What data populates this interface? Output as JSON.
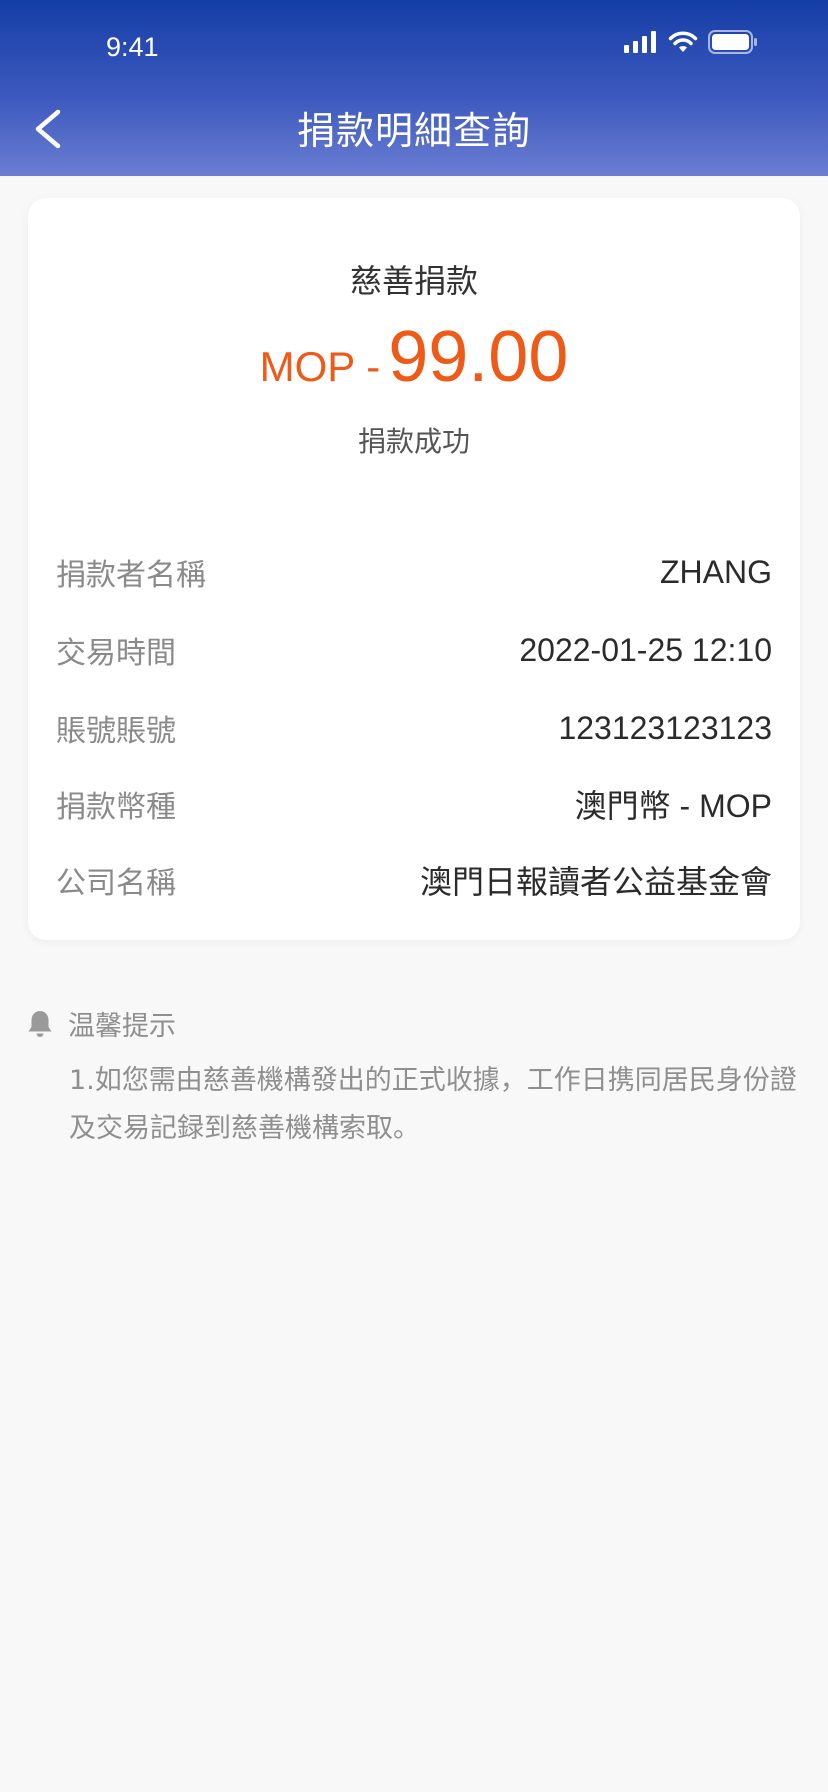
{
  "status_bar": {
    "time": "9:41"
  },
  "header": {
    "title": "捐款明細查詢"
  },
  "summary": {
    "title": "慈善捐款",
    "amount_prefix": "MOP -",
    "amount": "99.00",
    "status": "捐款成功"
  },
  "details": [
    {
      "label": "捐款者名稱",
      "value": "ZHANG"
    },
    {
      "label": "交易時間",
      "value": "2022-01-25 12:10"
    },
    {
      "label": "賬號賬號",
      "value": "123123123123"
    },
    {
      "label": "捐款幣種",
      "value": "澳門幣 - MOP"
    },
    {
      "label": "公司名稱",
      "value": "澳門日報讀者公益基金會"
    }
  ],
  "tips": {
    "title": "温馨提示",
    "text": "1.如您需由慈善機構發出的正式收據，工作日携同居民身份證及交易記録到慈善機構索取。"
  },
  "colors": {
    "header_top": "#143ea6",
    "header_bottom": "#6a7ed2",
    "amount": "#ee5a17",
    "background": "#f8f8f8"
  }
}
